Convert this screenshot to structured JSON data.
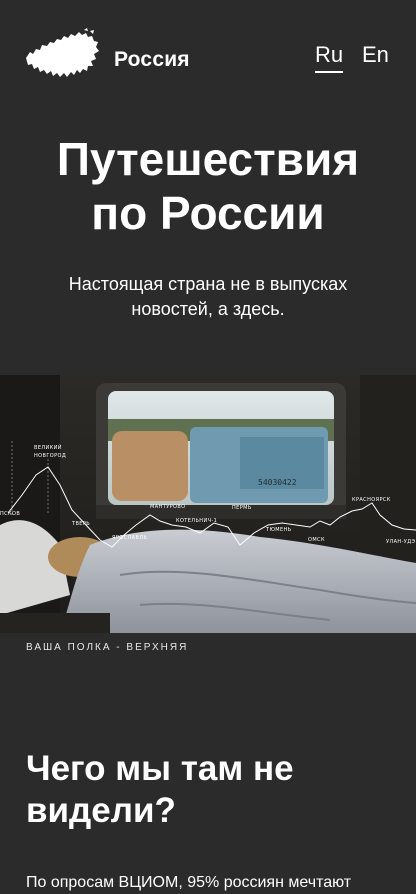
{
  "header": {
    "brand": "Россия",
    "logo_icon": "russia-map-icon",
    "lang_ru": "Ru",
    "lang_en": "En"
  },
  "hero": {
    "title_line1": "Путешествия",
    "title_line2": "по России",
    "subtitle_line1": "Настоящая страна не в выпусках",
    "subtitle_line2": "новостей, а здесь."
  },
  "photo": {
    "route_labels": {
      "pskov": "ПСКОВ",
      "veliky_novgorod_1": "ВЕЛИКИЙ",
      "veliky_novgorod_2": "НОВГОРОД",
      "tver": "ТВЕРЬ",
      "yaroslavl": "ЯРОСЛАВЛЬ",
      "mantrovo": "МАНТУРОВО",
      "kotelnich": "КОТЕЛЬНИЧ-1",
      "perm": "ПЕРМЬ",
      "tyumen": "ТЮМЕНЬ",
      "omsk": "ОМСК",
      "krasnoyarsk": "КРАСНОЯРСК",
      "ulan_ude": "УЛАН-УДЭ"
    },
    "wagon_text": "54030422",
    "caption": "ВАША ПОЛКА - ВЕРХНЯЯ"
  },
  "section": {
    "title_line1": "Чего мы там не",
    "title_line2": "видели?",
    "body": "По опросам ВЦИОМ, 95% россиян мечтают"
  },
  "colors": {
    "background": "#2b2b2b",
    "text": "#ffffff"
  }
}
